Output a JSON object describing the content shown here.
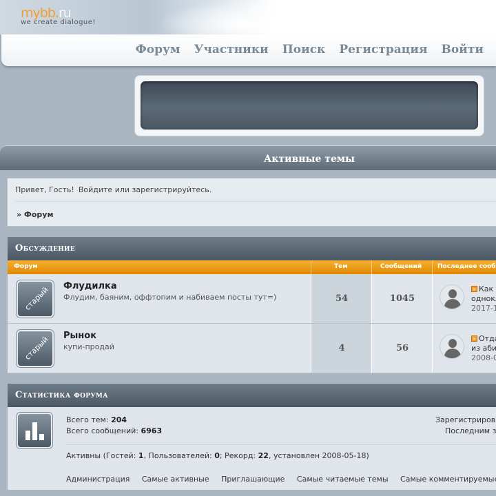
{
  "logo": {
    "main": "mybb.",
    "ru": "ru",
    "tagline": "we  create  dialogue!"
  },
  "nav": {
    "items": [
      "Форум",
      "Участники",
      "Поиск",
      "Регистрация",
      "Войти"
    ]
  },
  "page_title": "Активные темы",
  "guest": {
    "greeting": "Привет, Гость!",
    "links": "Войдите или зарегистрируйтесь.",
    "breadcrumb": "» Форум"
  },
  "forum_category": {
    "title": "Обсуждение",
    "columns": {
      "forum": "Форум",
      "topics": "Тем",
      "posts": "Сообщений",
      "last": "Последнее сооб"
    },
    "rows": [
      {
        "icon_label": "старый",
        "title": "Флудилка",
        "desc": "Флудим, баяним, оффтопим и набиваем посты тут=)",
        "topics": "54",
        "posts": "1045",
        "last_line1": "Как",
        "last_line2": "однокл",
        "last_date": "2017-1"
      },
      {
        "icon_label": "старый",
        "title": "Рынок",
        "desc": "купи-продай",
        "topics": "4",
        "posts": "56",
        "last_line1": "Отда",
        "last_line2": "из аби",
        "last_date": "2008-0"
      }
    ]
  },
  "stats": {
    "title": "Статистика форума",
    "topics_label": "Всего тем:",
    "topics_value": "204",
    "posts_label": "Всего сообщений:",
    "posts_value": "6963",
    "registered": "Зарегистриров",
    "last": "Последним з",
    "active_label": "Активны",
    "guests_label": "(Гостей:",
    "guests_value": "1",
    "users_label": ", Пользователей:",
    "users_value": "0",
    "record_label": "; Рекорд:",
    "record_value": "22",
    "record_date": ", установлен 2008-05-18)",
    "links": [
      "Администрация",
      "Самые активные",
      "Приглашающие",
      "Самые читаемые темы",
      "Самые комментируемые т"
    ]
  },
  "colors": {
    "accent": "#f0a030",
    "header_dark": "#4b5864",
    "background": "#a9b6c1"
  }
}
